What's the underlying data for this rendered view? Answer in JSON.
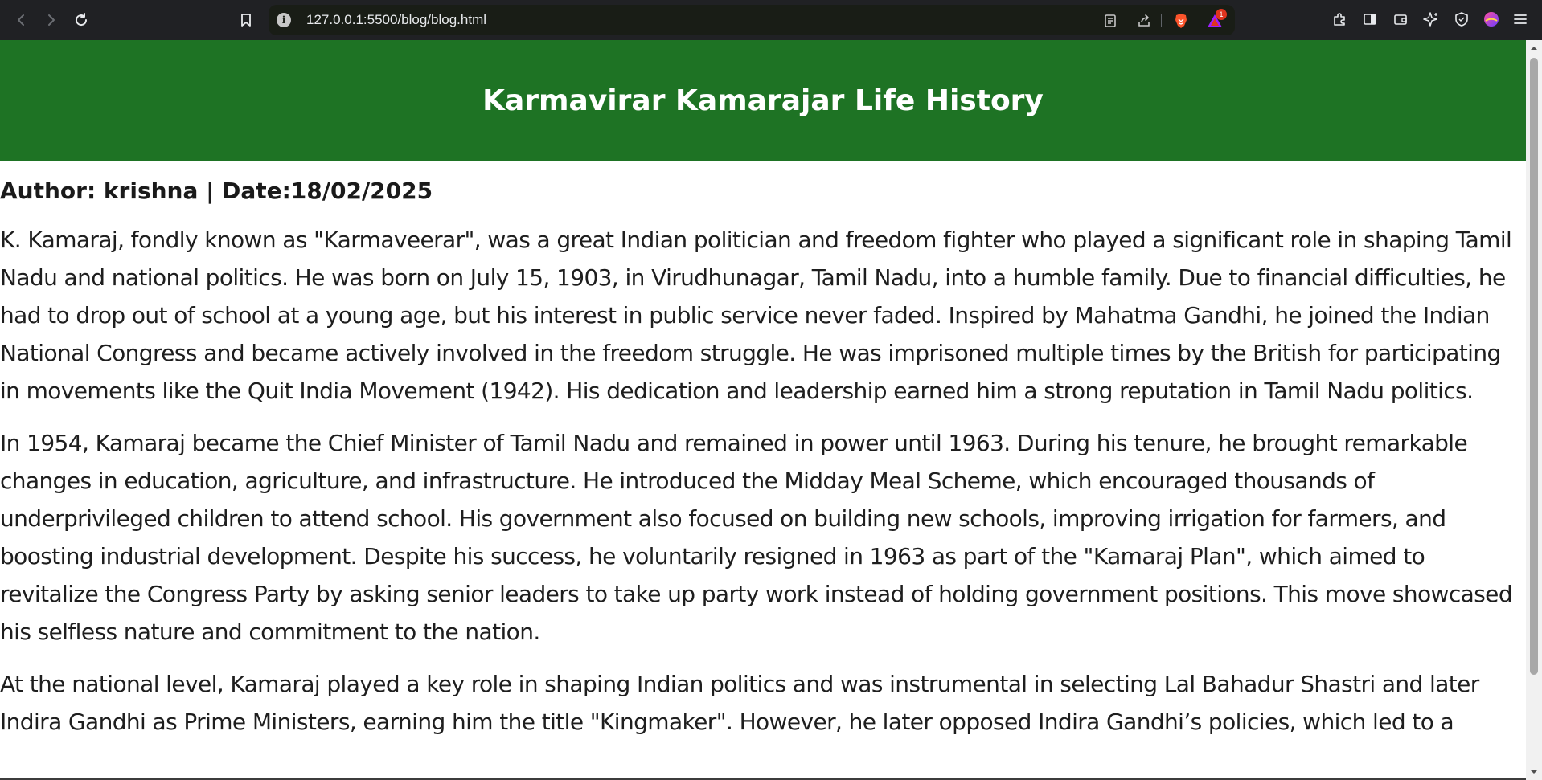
{
  "browser": {
    "url": "127.0.0.1:5500/blog/blog.html",
    "notification_count": "1"
  },
  "page": {
    "title": "Karmavirar Kamarajar Life History",
    "meta": "Author: krishna | Date:18/02/2025",
    "paragraphs": [
      "K. Kamaraj, fondly known as \"Karmaveerar\", was a great Indian politician and freedom fighter who played a significant role in shaping Tamil Nadu and national politics. He was born on July 15, 1903, in Virudhunagar, Tamil Nadu, into a humble family. Due to financial difficulties, he had to drop out of school at a young age, but his interest in public service never faded. Inspired by Mahatma Gandhi, he joined the Indian National Congress and became actively involved in the freedom struggle. He was imprisoned multiple times by the British for participating in movements like the Quit India Movement (1942). His dedication and leadership earned him a strong reputation in Tamil Nadu politics.",
      "In 1954, Kamaraj became the Chief Minister of Tamil Nadu and remained in power until 1963. During his tenure, he brought remarkable changes in education, agriculture, and infrastructure. He introduced the Midday Meal Scheme, which encouraged thousands of underprivileged children to attend school. His government also focused on building new schools, improving irrigation for farmers, and boosting industrial development. Despite his success, he voluntarily resigned in 1963 as part of the \"Kamaraj Plan\", which aimed to revitalize the Congress Party by asking senior leaders to take up party work instead of holding government positions. This move showcased his selfless nature and commitment to the nation.",
      "At the national level, Kamaraj played a key role in shaping Indian politics and was instrumental in selecting Lal Bahadur Shastri and later Indira Gandhi as Prime Ministers, earning him the title \"Kingmaker\". However, he later opposed Indira Gandhi’s policies, which led to a"
    ]
  },
  "colors": {
    "header_bg": "#1e7324",
    "chrome_bg": "#202124"
  }
}
